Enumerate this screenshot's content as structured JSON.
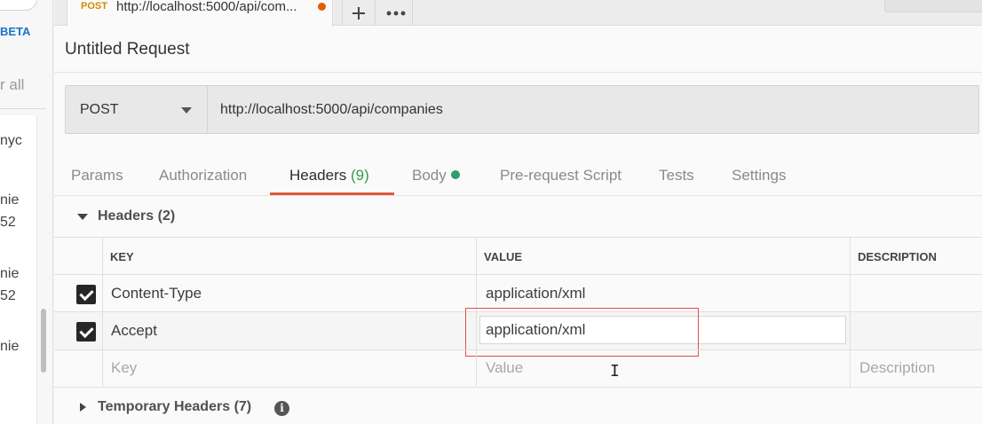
{
  "sidebar": {
    "beta_label": "BETA",
    "filter_text": "r all",
    "items": [
      "nyc",
      "nie",
      "52",
      "nie",
      "52",
      "nie"
    ]
  },
  "tabs": {
    "active": {
      "method": "POST",
      "url": "http://localhost:5000/api/com..."
    },
    "new_tab_icon": "plus-icon",
    "more_icon": "ellipsis-icon"
  },
  "request": {
    "title": "Untitled Request",
    "method": "POST",
    "url": "http://localhost:5000/api/companies"
  },
  "req_tabs": {
    "params": "Params",
    "authorization": "Authorization",
    "headers": "Headers",
    "headers_count": "(9)",
    "body": "Body",
    "prerequest": "Pre-request Script",
    "tests": "Tests",
    "settings": "Settings"
  },
  "headers_section": {
    "title": "Headers",
    "count": "(2)",
    "columns": {
      "key": "KEY",
      "value": "VALUE",
      "description": "DESCRIPTION"
    },
    "rows": [
      {
        "checked": true,
        "key": "Content-Type",
        "value": "application/xml"
      },
      {
        "checked": true,
        "key": "Accept",
        "value": "application/xml"
      }
    ],
    "placeholder": {
      "key": "Key",
      "value": "Value",
      "description": "Description"
    }
  },
  "temporary_headers": {
    "title": "Temporary Headers",
    "count": "(7)",
    "info_icon": "info-icon"
  },
  "colors": {
    "accent": "#e0583b",
    "count_green": "#2e9e4b",
    "unsaved_dot": "#e06000",
    "highlight_box": "#e05046"
  }
}
